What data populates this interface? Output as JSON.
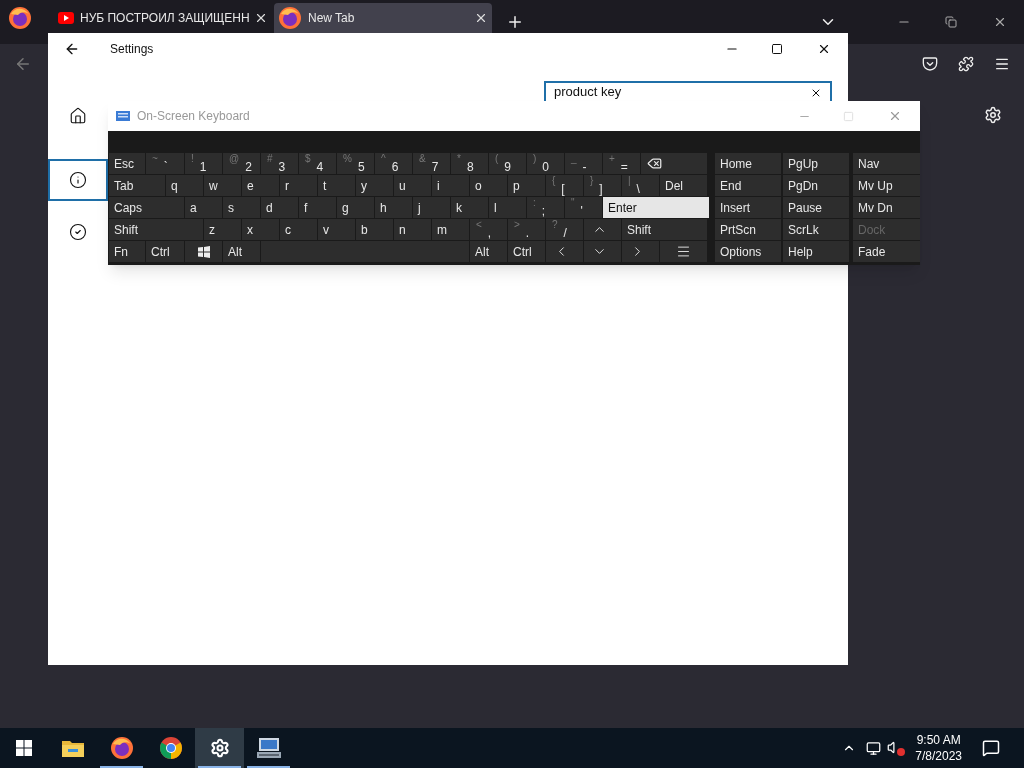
{
  "browser": {
    "tabs": [
      {
        "kind": "video",
        "title": "НУБ ПОСТРОИЛ ЗАЩИЩЕНН",
        "selected": false
      },
      {
        "kind": "browser",
        "title": "New Tab",
        "selected": true
      }
    ]
  },
  "settings": {
    "title": "Settings",
    "search": {
      "value": "product key"
    },
    "nav": [
      {
        "kind": "home",
        "selected": false
      },
      {
        "kind": "info",
        "selected": true
      },
      {
        "kind": "check",
        "selected": false
      }
    ]
  },
  "keyboard": {
    "title": "On-Screen Keyboard",
    "rows": [
      {
        "keys": [
          {
            "kind": "text",
            "label": "Esc"
          },
          {
            "kind": "dual",
            "shift": "~",
            "label": "`"
          },
          {
            "kind": "dual",
            "shift": "!",
            "label": "1"
          },
          {
            "kind": "dual",
            "shift": "@",
            "label": "2"
          },
          {
            "kind": "dual",
            "shift": "#",
            "label": "3"
          },
          {
            "kind": "dual",
            "shift": "$",
            "label": "4"
          },
          {
            "kind": "dual",
            "shift": "%",
            "label": "5"
          },
          {
            "kind": "dual",
            "shift": "^",
            "label": "6"
          },
          {
            "kind": "dual",
            "shift": "&",
            "label": "7"
          },
          {
            "kind": "dual",
            "shift": "*",
            "label": "8"
          },
          {
            "kind": "dual",
            "shift": "(",
            "label": "9"
          },
          {
            "kind": "dual",
            "shift": ")",
            "label": "0"
          },
          {
            "kind": "dual",
            "shift": "_",
            "label": "-"
          },
          {
            "kind": "dual",
            "shift": "+",
            "label": "="
          },
          {
            "kind": "backspace"
          }
        ]
      },
      {
        "keys": [
          {
            "kind": "text",
            "label": "Tab"
          },
          {
            "kind": "text",
            "label": "q"
          },
          {
            "kind": "text",
            "label": "w"
          },
          {
            "kind": "text",
            "label": "e"
          },
          {
            "kind": "text",
            "label": "r"
          },
          {
            "kind": "text",
            "label": "t"
          },
          {
            "kind": "text",
            "label": "y"
          },
          {
            "kind": "text",
            "label": "u"
          },
          {
            "kind": "text",
            "label": "i"
          },
          {
            "kind": "text",
            "label": "o"
          },
          {
            "kind": "text",
            "label": "p"
          },
          {
            "kind": "dual",
            "shift": "{",
            "label": "["
          },
          {
            "kind": "dual",
            "shift": "}",
            "label": "]"
          },
          {
            "kind": "dual",
            "shift": "|",
            "label": "\\"
          },
          {
            "kind": "text",
            "label": "Del"
          }
        ]
      },
      {
        "keys": [
          {
            "kind": "text",
            "label": "Caps"
          },
          {
            "kind": "text",
            "label": "a"
          },
          {
            "kind": "text",
            "label": "s"
          },
          {
            "kind": "text",
            "label": "d"
          },
          {
            "kind": "text",
            "label": "f"
          },
          {
            "kind": "text",
            "label": "g"
          },
          {
            "kind": "text",
            "label": "h"
          },
          {
            "kind": "text",
            "label": "j"
          },
          {
            "kind": "text",
            "label": "k"
          },
          {
            "kind": "text",
            "label": "l"
          },
          {
            "kind": "dual",
            "shift": ":",
            "label": ";"
          },
          {
            "kind": "dual",
            "shift": "\"",
            "label": "'"
          },
          {
            "kind": "text",
            "label": "Enter",
            "selected": true
          }
        ]
      },
      {
        "keys": [
          {
            "kind": "text",
            "label": "Shift"
          },
          {
            "kind": "text",
            "label": "z"
          },
          {
            "kind": "text",
            "label": "x"
          },
          {
            "kind": "text",
            "label": "c"
          },
          {
            "kind": "text",
            "label": "v"
          },
          {
            "kind": "text",
            "label": "b"
          },
          {
            "kind": "text",
            "label": "n"
          },
          {
            "kind": "text",
            "label": "m"
          },
          {
            "kind": "dual",
            "shift": "<",
            "label": ","
          },
          {
            "kind": "dual",
            "shift": ">",
            "label": "."
          },
          {
            "kind": "dual",
            "shift": "?",
            "label": "/"
          },
          {
            "kind": "up"
          },
          {
            "kind": "text",
            "label": "Shift"
          }
        ]
      },
      {
        "keys": [
          {
            "kind": "text",
            "label": "Fn"
          },
          {
            "kind": "text",
            "label": "Ctrl"
          },
          {
            "kind": "windows"
          },
          {
            "kind": "text",
            "label": "Alt"
          },
          {
            "kind": "space"
          },
          {
            "kind": "text",
            "label": "Alt"
          },
          {
            "kind": "text",
            "label": "Ctrl"
          },
          {
            "kind": "left"
          },
          {
            "kind": "down"
          },
          {
            "kind": "right"
          },
          {
            "kind": "menu"
          }
        ]
      }
    ],
    "side": [
      [
        {
          "label": "Home"
        },
        {
          "label": "PgUp"
        },
        {
          "label": "Nav"
        }
      ],
      [
        {
          "label": "End"
        },
        {
          "label": "PgDn"
        },
        {
          "label": "Mv Up"
        }
      ],
      [
        {
          "label": "Insert"
        },
        {
          "label": "Pause"
        },
        {
          "label": "Mv Dn"
        }
      ],
      [
        {
          "label": "PrtScn"
        },
        {
          "label": "ScrLk"
        },
        {
          "label": "Dock",
          "disabled": true
        }
      ],
      [
        {
          "label": "Options"
        },
        {
          "label": "Help"
        },
        {
          "label": "Fade"
        }
      ]
    ]
  },
  "taskbar": {
    "apps": [
      {
        "kind": "folder",
        "running": false,
        "active": false
      },
      {
        "kind": "firefox",
        "running": true,
        "active": false
      },
      {
        "kind": "chrome",
        "running": false,
        "active": false
      },
      {
        "kind": "settings",
        "running": true,
        "active": true
      },
      {
        "kind": "keyboard",
        "running": true,
        "active": false
      }
    ],
    "time": "9:50 AM",
    "date": "7/8/2023"
  }
}
